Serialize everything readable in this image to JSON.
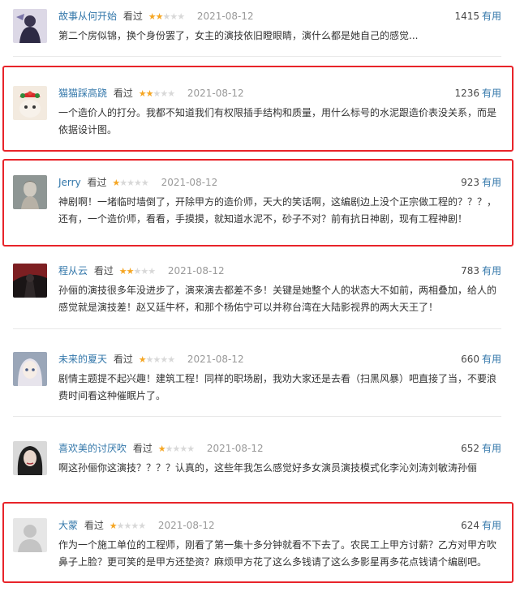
{
  "comments": [
    {
      "username": "故事从何开始",
      "action": "看过",
      "rating": 2,
      "date": "2021-08-12",
      "votes": "1415",
      "useful_label": "有用",
      "text": "第二个房似锦，换个身份罢了，女主的演技依旧瞪眼睛，演什么都是她自己的感觉...",
      "highlighted": false,
      "avatar": "avatar-dark-figure"
    },
    {
      "username": "猫猫踩高跷",
      "action": "看过",
      "rating": 2,
      "date": "2021-08-12",
      "votes": "1236",
      "useful_label": "有用",
      "text": "一个造价人的打分。我都不知道我们有权限插手结构和质量，用什么标号的水泥跟造价表没关系，而是依据设计图。",
      "highlighted": true,
      "avatar": "avatar-cat-christmas"
    },
    {
      "username": "Jerry",
      "action": "看过",
      "rating": 1,
      "date": "2021-08-12",
      "votes": "923",
      "useful_label": "有用",
      "text": "神剧啊！一堵临时墙倒了，开除甲方的造价师，天大的笑话啊，这编剧边上没个正宗做工程的？？？，还有，一个造价师，看看，手摸摸，就知道水泥不，砂子不对？前有抗日神剧，现有工程神剧！",
      "highlighted": true,
      "avatar": "avatar-statue"
    },
    {
      "username": "程从云",
      "action": "看过",
      "rating": 2,
      "date": "2021-08-12",
      "votes": "783",
      "useful_label": "有用",
      "text": "孙俪的演技很多年没进步了，演来演去都差不多！关键是她整个人的状态大不如前，两相叠加，给人的感觉就是演技差！赵又廷牛杯，和那个杨佑宁可以并称台湾在大陆影视界的两大天王了！",
      "highlighted": false,
      "avatar": "avatar-dark-red"
    },
    {
      "username": "未来的夏天",
      "action": "看过",
      "rating": 1,
      "date": "2021-08-12",
      "votes": "660",
      "useful_label": "有用",
      "text": "剧情主题提不起兴趣！建筑工程！同样的职场剧，我劝大家还是去看（扫黑风暴）吧直接了当，不要浪费时间看这种催眠片了。",
      "highlighted": false,
      "avatar": "avatar-anime"
    },
    {
      "username": "喜欢美的讨厌吹",
      "action": "看过",
      "rating": 1,
      "date": "2021-08-12",
      "votes": "652",
      "useful_label": "有用",
      "text": "啊这孙俪你这演技？？？？认真的，这些年我怎么感觉好多女演员演技模式化李沁刘涛刘敏涛孙俪",
      "highlighted": false,
      "avatar": "avatar-woman-portrait"
    },
    {
      "username": "大蒙",
      "action": "看过",
      "rating": 1,
      "date": "2021-08-12",
      "votes": "624",
      "useful_label": "有用",
      "text": "作为一个施工单位的工程师，刚看了第一集十多分钟就看不下去了。农民工上甲方讨薪？乙方对甲方吹鼻子上脸？更可笑的是甲方还垫资？麻烦甲方花了这么多钱请了这么多影星再多花点钱请个编剧吧。",
      "highlighted": true,
      "avatar": "avatar-default-user"
    }
  ]
}
